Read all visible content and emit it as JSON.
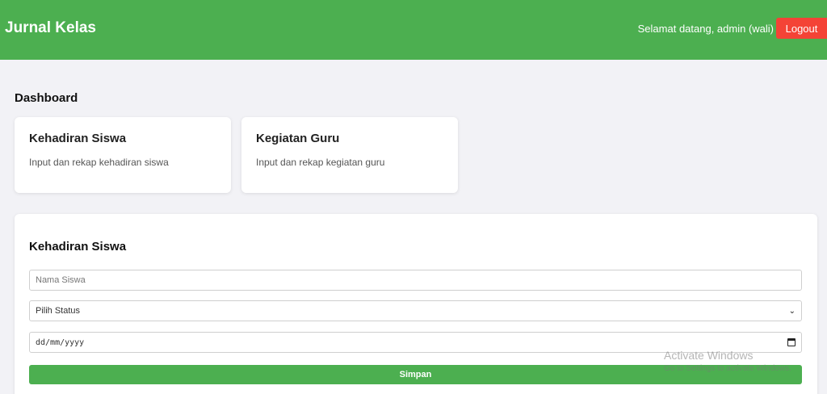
{
  "header": {
    "brand": "Jurnal Kelas",
    "welcome": "Selamat datang, admin (wali)",
    "logout_label": "Logout"
  },
  "dashboard": {
    "title": "Dashboard",
    "cards": [
      {
        "title": "Kehadiran Siswa",
        "desc": "Input dan rekap kehadiran siswa"
      },
      {
        "title": "Kegiatan Guru",
        "desc": "Input dan rekap kegiatan guru"
      }
    ]
  },
  "form": {
    "title": "Kehadiran Siswa",
    "nama_placeholder": "Nama Siswa",
    "status_selected": "Pilih Status",
    "date_placeholder": "dd/mm/yyyy",
    "submit_label": "Simpan"
  },
  "watermark": {
    "line1": "Activate Windows",
    "line2": "Go to Settings to activate Windows."
  },
  "colors": {
    "primary": "#4caf50",
    "danger": "#f44336",
    "background": "#f2f2f6"
  }
}
